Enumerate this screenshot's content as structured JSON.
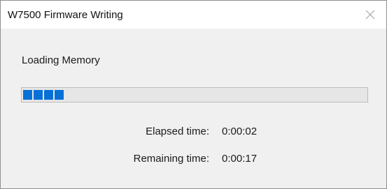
{
  "window": {
    "title": "W7500 Firmware Writing",
    "close_icon": "close-icon"
  },
  "dialog": {
    "status": "Loading Memory",
    "progress": {
      "segments_filled": 4,
      "fill_fraction": 0.11,
      "color": "#0670d6"
    },
    "elapsed": {
      "label": "Elapsed time:",
      "value": "0:00:02"
    },
    "remaining": {
      "label": "Remaining time:",
      "value": "0:00:17"
    }
  }
}
